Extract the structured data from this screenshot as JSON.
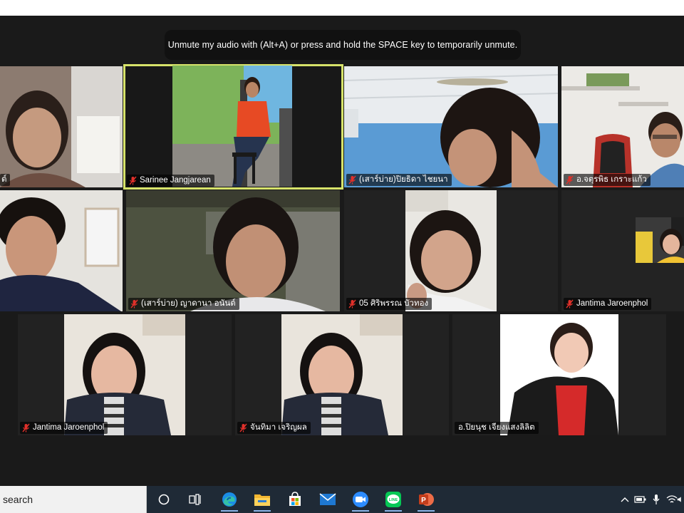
{
  "meeting": {
    "unmute_toast": "Unmute my audio with (Alt+A) or press and hold the SPACE key to temporarily unmute."
  },
  "participants": [
    {
      "name": "ต์",
      "muted": true,
      "active": false
    },
    {
      "name": "Sarinee Jangjarean",
      "muted": true,
      "active": true
    },
    {
      "name": "(เสาร์บ่าย)ปิยธิดา ไชยนา",
      "muted": true,
      "active": false
    },
    {
      "name": "อ.จตุรพิธ เกราะแก้ว",
      "muted": true,
      "active": false
    },
    {
      "name": "",
      "muted": false,
      "active": false
    },
    {
      "name": "(เสาร์บ่าย) ญาดานา อนันต์",
      "muted": true,
      "active": false
    },
    {
      "name": "05 ศิริพรรณ บัวทอง",
      "muted": true,
      "active": false
    },
    {
      "name": "Jantima Jaroenphol",
      "muted": true,
      "active": false
    },
    {
      "name": "Jantima Jaroenphol",
      "muted": true,
      "active": false
    },
    {
      "name": "จันทิมา เจริญผล",
      "muted": true,
      "active": false
    },
    {
      "name": "อ.ปิยนุช เจียงแสงลิลิต",
      "muted": false,
      "active": false
    }
  ],
  "taskbar": {
    "search_text": "search",
    "apps": [
      {
        "icon": "task-view-icon"
      },
      {
        "icon": "edge-browser-icon"
      },
      {
        "icon": "file-explorer-icon"
      },
      {
        "icon": "microsoft-store-icon"
      },
      {
        "icon": "mail-icon"
      },
      {
        "icon": "zoom-icon"
      },
      {
        "icon": "line-app-icon"
      },
      {
        "icon": "powerpoint-icon"
      }
    ],
    "line_label": "LINE",
    "ppt_letter": "P"
  },
  "colors": {
    "active_border": "#d7e36a",
    "mute_red": "#e0302a",
    "taskbar_bg": "#1f2a36"
  }
}
